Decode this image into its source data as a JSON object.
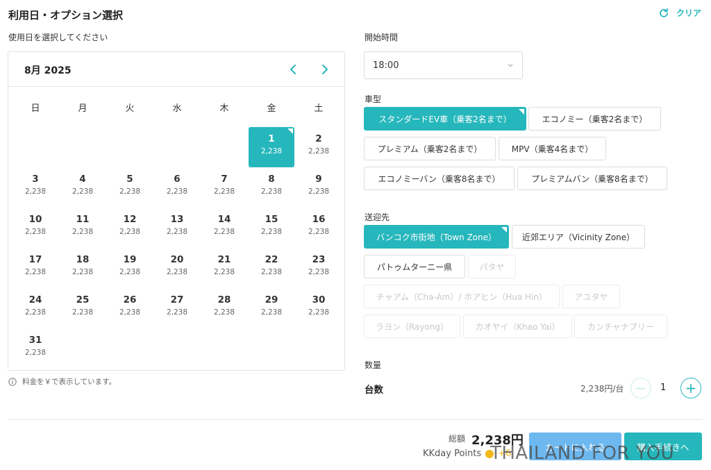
{
  "header": {
    "title": "利用日・オプション選択",
    "clear_label": "クリア"
  },
  "calendar": {
    "label": "使用日を選択してください",
    "month": "8月 2025",
    "weekdays": [
      "日",
      "月",
      "火",
      "水",
      "木",
      "金",
      "土"
    ],
    "days": [
      {
        "d": "1",
        "p": "2,238"
      },
      {
        "d": "2",
        "p": "2,238"
      },
      {
        "d": "3",
        "p": "2,238"
      },
      {
        "d": "4",
        "p": "2,238"
      },
      {
        "d": "5",
        "p": "2,238"
      },
      {
        "d": "6",
        "p": "2,238"
      },
      {
        "d": "7",
        "p": "2,238"
      },
      {
        "d": "8",
        "p": "2,238"
      },
      {
        "d": "9",
        "p": "2,238"
      },
      {
        "d": "10",
        "p": "2,238"
      },
      {
        "d": "11",
        "p": "2,238"
      },
      {
        "d": "12",
        "p": "2,238"
      },
      {
        "d": "13",
        "p": "2,238"
      },
      {
        "d": "14",
        "p": "2,238"
      },
      {
        "d": "15",
        "p": "2,238"
      },
      {
        "d": "16",
        "p": "2,238"
      },
      {
        "d": "17",
        "p": "2,238"
      },
      {
        "d": "18",
        "p": "2,238"
      },
      {
        "d": "19",
        "p": "2,238"
      },
      {
        "d": "20",
        "p": "2,238"
      },
      {
        "d": "21",
        "p": "2,238"
      },
      {
        "d": "22",
        "p": "2,238"
      },
      {
        "d": "23",
        "p": "2,238"
      },
      {
        "d": "24",
        "p": "2,238"
      },
      {
        "d": "25",
        "p": "2,238"
      },
      {
        "d": "26",
        "p": "2,238"
      },
      {
        "d": "27",
        "p": "2,238"
      },
      {
        "d": "28",
        "p": "2,238"
      },
      {
        "d": "29",
        "p": "2,238"
      },
      {
        "d": "30",
        "p": "2,238"
      },
      {
        "d": "31",
        "p": "2,238"
      }
    ],
    "selected_day": "1",
    "note": "料金を￥で表示しています。"
  },
  "start_time": {
    "label": "開始時間",
    "value": "18:00"
  },
  "vehicle": {
    "label": "車型",
    "options": [
      "スタンダードEV車（乗客2名まで）",
      "エコノミー（乗客2名まで）",
      "プレミアム（乗客2名まで）",
      "MPV（乗客4名まで）",
      "エコノミーバン（乗客8名まで）",
      "プレミアムバン（乗客8名まで）"
    ],
    "selected": "スタンダードEV車（乗客2名まで）"
  },
  "destination": {
    "label": "送迎先",
    "options": [
      "バンコク市街地（Town Zone）",
      "近郊エリア（Vicinity Zone）",
      "パトゥムターニー県",
      "パタヤ",
      "チャアム（Cha-Am）/ ホアヒン（Hua Hin）",
      "アユタヤ",
      "ラヨン（Rayong）",
      "カオヤイ（Khao Yai）",
      "カンチャナブリー"
    ],
    "selected": "バンコク市街地（Town Zone）",
    "disabled": [
      "パタヤ",
      "チャアム（Cha-Am）/ ホアヒン（Hua Hin）",
      "アユタヤ",
      "ラヨン（Rayong）",
      "カオヤイ（Khao Yai）",
      "カンチャナブリー"
    ]
  },
  "quantity": {
    "label": "数量",
    "item": "台数",
    "unit_price": "2,238円/台",
    "value": "1"
  },
  "footer": {
    "total_label": "総額",
    "total_value": "2,238円",
    "points_label": "KKday Points",
    "points_value": "+6",
    "cart_label": "カートに入れる",
    "buy_label": "購入手続きへ"
  },
  "watermark": "THAILAND FOR YOU",
  "colors": {
    "accent": "#26b7bc",
    "cart_button": "#6eb8f0",
    "coin": "#f2b81a"
  }
}
